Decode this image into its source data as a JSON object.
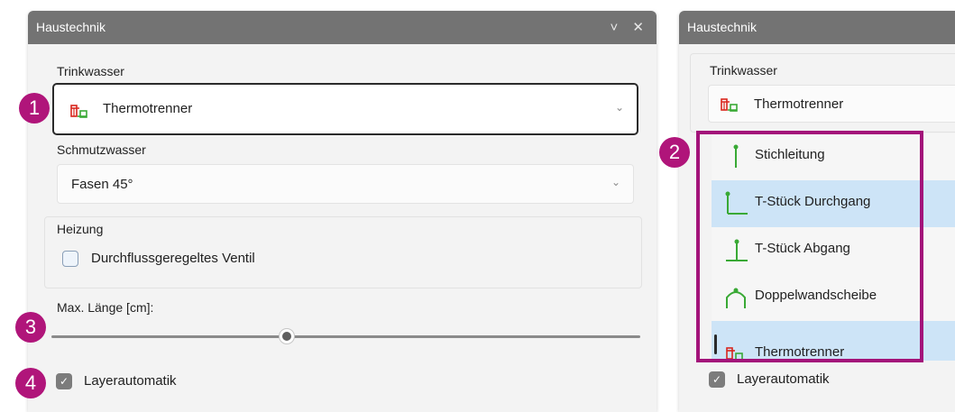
{
  "colors": {
    "titlebar": "#737373",
    "badge": "#b0157a",
    "selection": "#cde4f7"
  },
  "left_panel": {
    "title": "Haustechnik",
    "window_controls": {
      "collapse": "˅",
      "close": "✕"
    },
    "trinkwasser": {
      "label": "Trinkwasser",
      "value": "Thermotrenner",
      "icon": "thermotrenner-icon"
    },
    "schmutzwasser": {
      "label": "Schmutzwasser",
      "value": "Fasen 45°"
    },
    "heizung": {
      "label": "Heizung",
      "checkbox_label": "Durchflussgeregeltes Ventil",
      "checked": false
    },
    "max_laenge": {
      "label": "Max. Länge [cm]:",
      "slider_fraction": 0.4
    },
    "layerautomatik": {
      "label": "Layerautomatik",
      "checked": true,
      "check_glyph": "✓"
    }
  },
  "right_panel": {
    "title": "Haustechnik",
    "trinkwasser": {
      "label": "Trinkwasser",
      "value": "Thermotrenner"
    },
    "dropdown_items": [
      {
        "label": "Stichleitung",
        "icon": "stichleitung-icon",
        "selected": false
      },
      {
        "label": "T-Stück Durchgang",
        "icon": "t-stueck-durchgang-icon",
        "selected": true
      },
      {
        "label": "T-Stück Abgang",
        "icon": "t-stueck-abgang-icon",
        "selected": false
      },
      {
        "label": "Doppelwandscheibe",
        "icon": "doppelwandscheibe-icon",
        "selected": false
      },
      {
        "label": "Thermotrenner",
        "icon": "thermotrenner-icon",
        "selected": true
      }
    ],
    "layerautomatik": {
      "label": "Layerautomatik",
      "checked": true,
      "check_glyph": "✓"
    }
  },
  "badges": [
    "1",
    "2",
    "3",
    "4"
  ]
}
